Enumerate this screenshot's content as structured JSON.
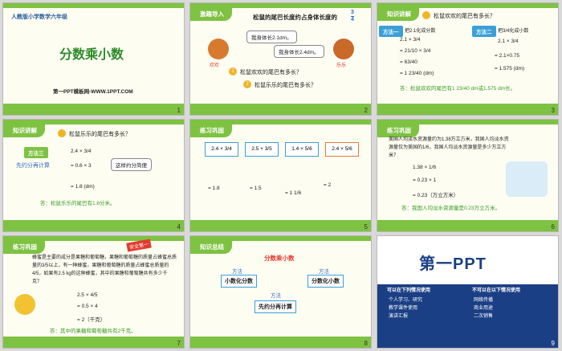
{
  "slides": [
    {
      "num": "1",
      "header": "人教版小学数学六年级",
      "title": "分数乘小数",
      "footer": "第一PPT模板网-WWW.1PPT.COM"
    },
    {
      "num": "2",
      "header": "激趣导入",
      "question": "松鼠的尾巴长度约占身体长度的",
      "frac_num": "3",
      "frac_den": "4",
      "bubble1": "我身体长2.1dm。",
      "bubble2": "我身体长2.4dm。",
      "name1": "欢欢",
      "name2": "乐乐",
      "q1": "松鼠欢欢的尾巴有多长？",
      "q2": "松鼠乐乐的尾巴有多长？",
      "q1_num": "1",
      "q2_num": "2"
    },
    {
      "num": "3",
      "header": "知识讲解",
      "question": "松鼠欢欢的尾巴有多长？",
      "method1": "方法一",
      "method1_text": "把2.1化成分数",
      "method2": "方法二",
      "method2_text": "把3/4化成小数",
      "m1_lines": [
        "2.1 × 3/4",
        "= 21/10 × 3/4",
        "= 63/40",
        "= 1 23/40 (dm)"
      ],
      "m2_lines": [
        "2.1 × 3/4",
        "= 2.1×0.75",
        "= 1.575 (dm)"
      ],
      "answer": "答：松鼠欢欢的尾巴有1 23/40 dm或1.575 dm长。"
    },
    {
      "num": "4",
      "header": "知识讲解",
      "question": "松鼠乐乐的尾巴有多长？",
      "method3": "方法三",
      "method3_text": "先约分再计算",
      "lines": [
        "2.4 × 3/4",
        "= 0.6 × 3",
        "= 1.8 (dm)"
      ],
      "comment": "这样约分简便",
      "answer": "答：松鼠乐乐的尾巴有1.8分米。"
    },
    {
      "num": "5",
      "header": "练习巩固",
      "exprs": [
        "2.4 × 3/4",
        "2.5 × 3/5",
        "1.4 × 5/6",
        "2.4 × 5/6"
      ],
      "results": [
        "= 1.8",
        "= 1.5",
        "= 1 1/6",
        "= 2"
      ]
    },
    {
      "num": "6",
      "header": "练习巩固",
      "problem": "美国人均淡水资源量约为1.38万立方米，我国人均淡水资源量仅为美国的1/6，我国人均淡水资源量是多少万立方米？",
      "lines": [
        "1.38 × 1/6",
        "= 0.23 × 1",
        "= 0.23（万立方米）"
      ],
      "answer": "答：我国人均淡水资源量是0.23万立方米。"
    },
    {
      "num": "7",
      "header": "练习巩固",
      "tag": "安全第一",
      "problem": "蜂蜜是主要的成分是果糖和葡萄糖，果糖和葡萄糖的质量占蜂蜜总质量的3/5以上，有一种蜂蜜，果糖和葡萄糖的质量占蜂蜜总质量的4/5，如果有2.5 kg的这种蜂蜜，其中的果糖和葡萄糖共有多少千克？",
      "lines": [
        "2.5 × 4/5",
        "= 0.5 × 4",
        "= 2（千克）"
      ],
      "answer": "答：其中的果糖和葡萄糖共有2千克。"
    },
    {
      "num": "8",
      "header": "知识总结",
      "center": "分数乘小数",
      "method_label": "方法",
      "branch1": "小数化分数",
      "branch2": "分数化小数",
      "branch3": "先约分再计算"
    },
    {
      "num": "9",
      "logo": "第一PPT",
      "col1_title": "可以在下列情况使用",
      "col2_title": "不可以在以下情况使用",
      "col1_lines": [
        "个人学习、研究",
        "教学课件使用",
        "演讲汇报"
      ],
      "col2_lines": [
        "网络传播",
        "商业用途",
        "二次销售"
      ]
    }
  ]
}
